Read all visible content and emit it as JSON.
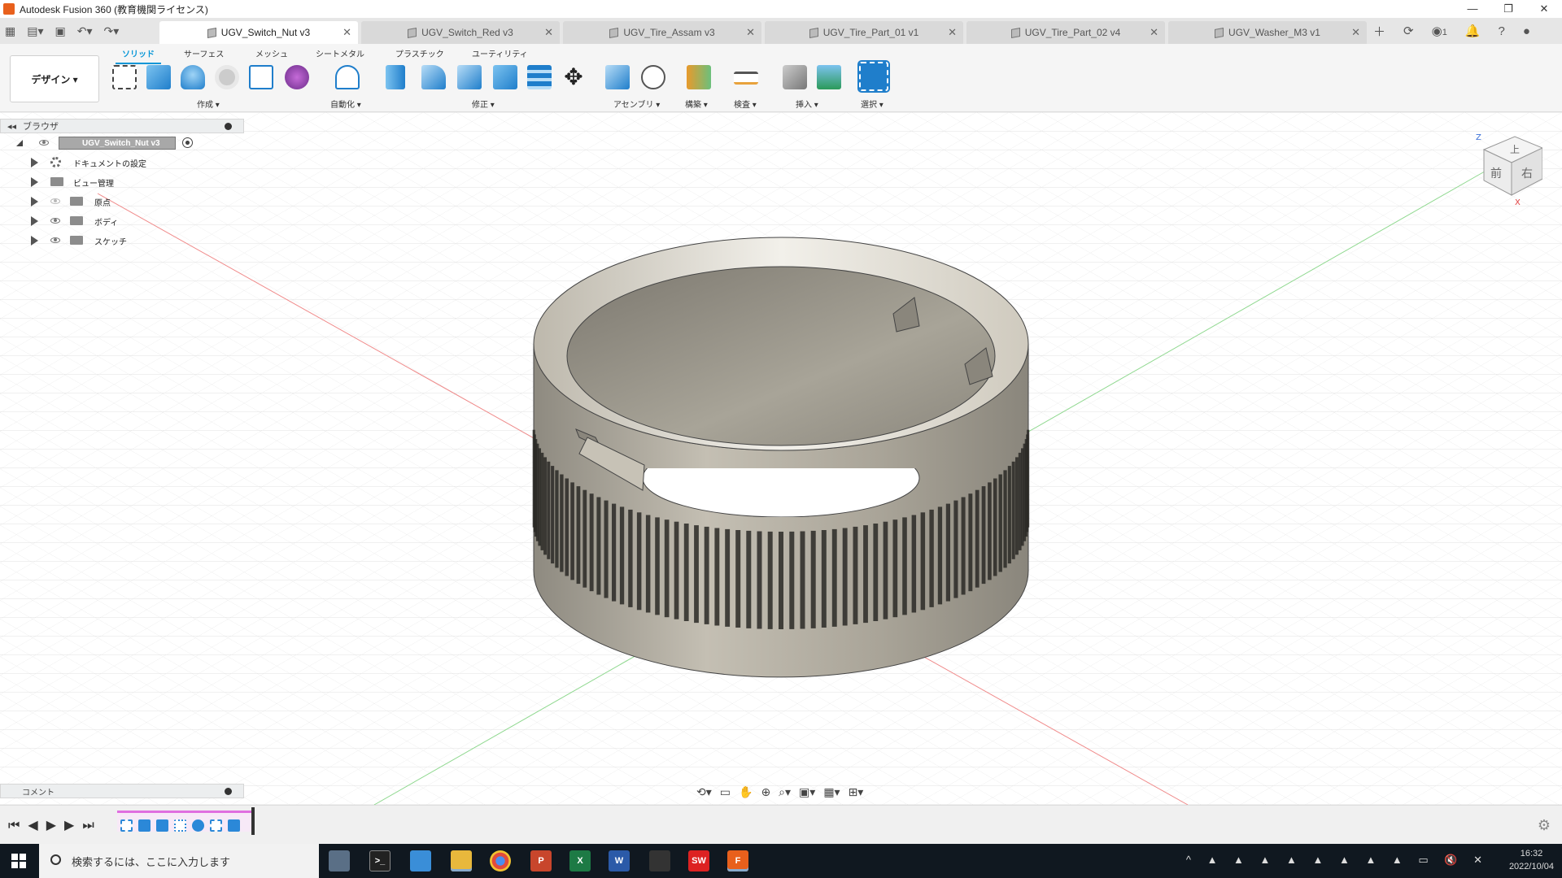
{
  "app": {
    "window_title": "Autodesk Fusion 360 (教育機関ライセンス)"
  },
  "window_controls": [
    "—",
    "❐",
    "✕"
  ],
  "doc_tabs": [
    {
      "label": "UGV_Switch_Nut v3",
      "active": true
    },
    {
      "label": "UGV_Switch_Red v3",
      "active": false
    },
    {
      "label": "UGV_Tire_Assam v3",
      "active": false
    },
    {
      "label": "UGV_Tire_Part_01 v1",
      "active": false
    },
    {
      "label": "UGV_Tire_Part_02 v4",
      "active": false
    },
    {
      "label": "UGV_Washer_M3 v1",
      "active": false
    }
  ],
  "tab_right": {
    "job_count": "1"
  },
  "ribbon": {
    "workspace": "デザイン ▾",
    "tabs": [
      "ソリッド",
      "サーフェス",
      "メッシュ",
      "シートメタル",
      "プラスチック",
      "ユーティリティ"
    ],
    "groups": [
      "作成 ▾",
      "自動化 ▾",
      "修正 ▾",
      "アセンブリ ▾",
      "構築 ▾",
      "検査 ▾",
      "挿入 ▾",
      "選択 ▾"
    ]
  },
  "browser": {
    "title": "ブラウザ",
    "root": "UGV_Switch_Nut v3",
    "items": [
      {
        "label": "ドキュメントの設定",
        "icon": "gear-icon"
      },
      {
        "label": "ビュー管理",
        "icon": "folder-icon"
      },
      {
        "label": "原点",
        "icon": "folder-icon"
      },
      {
        "label": "ボディ",
        "icon": "folder-icon"
      },
      {
        "label": "スケッチ",
        "icon": "folder-icon"
      }
    ]
  },
  "comment": {
    "label": "コメント"
  },
  "viewcube": {
    "top": "上",
    "front": "前",
    "right": "右",
    "axis_z": "Z",
    "axis_x": "X"
  },
  "taskbar": {
    "search_placeholder": "検索するには、ここに入力します",
    "time": "16:32",
    "date": "2022/10/04",
    "apps": [
      "cloud-app",
      "terminal-app",
      "notes-app",
      "explorer-app",
      "chrome-app",
      "powerpoint-app",
      "excel-app",
      "word-app",
      "game-app",
      "solidworks-app",
      "fusion-app"
    ]
  },
  "colors": {
    "accent": "#0696d7",
    "fusion": "#e8601c",
    "part": "#b7b2a6"
  }
}
